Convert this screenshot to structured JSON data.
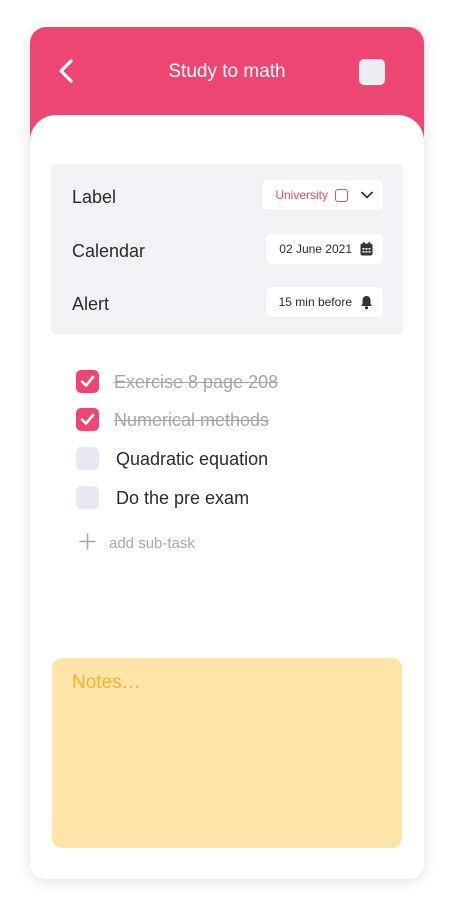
{
  "header": {
    "title": "Study to math",
    "back_icon": "chevron-left-icon",
    "complete_checkbox_checked": false
  },
  "settings": {
    "label": {
      "name": "Label",
      "value": "University",
      "icon": "chevron-down-icon"
    },
    "calendar": {
      "name": "Calendar",
      "value": "02 June 2021",
      "icon": "calendar-icon"
    },
    "alert": {
      "name": "Alert",
      "value": "15 min before",
      "icon": "bell-icon"
    }
  },
  "tasks": [
    {
      "text": "Exercise 8 page 208",
      "checked": true
    },
    {
      "text": "Numerical methods",
      "checked": true
    },
    {
      "text": "Quadratic equation",
      "checked": false
    },
    {
      "text": "Do the pre exam",
      "checked": false
    }
  ],
  "add_subtask": {
    "label": "add sub-task",
    "icon": "plus-icon"
  },
  "notes": {
    "placeholder": "Notes…"
  },
  "colors": {
    "accent": "#EE4672",
    "notes_bg": "#FFE4A8",
    "notes_text": "#F2B331",
    "panel_bg": "#F3F3F7"
  }
}
